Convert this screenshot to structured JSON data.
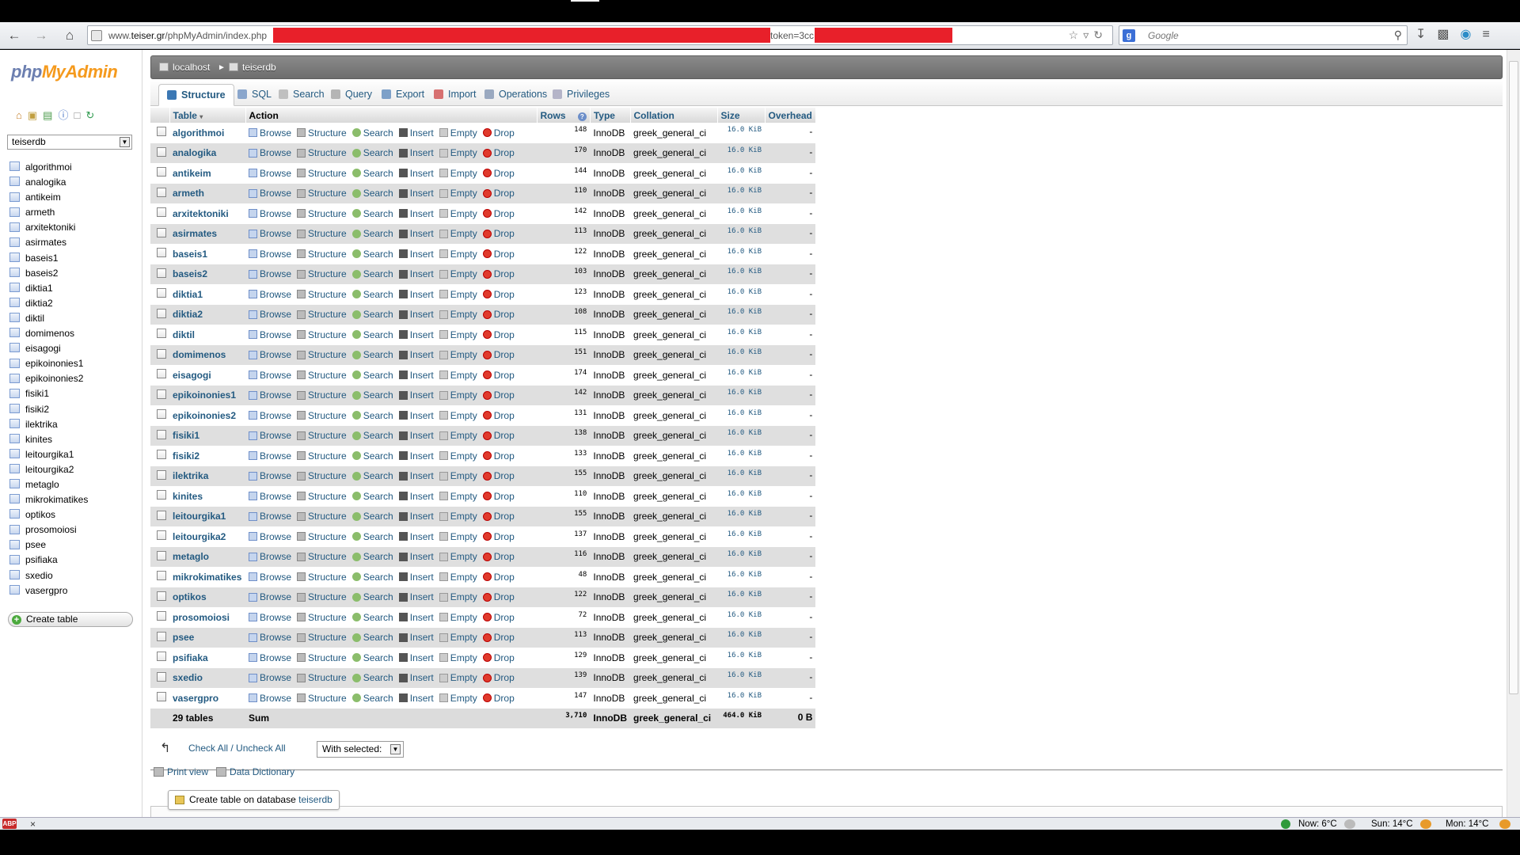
{
  "browser": {
    "url_prefix": "www.",
    "url_domain": "teiser.gr",
    "url_path": "/phpMyAdmin/index.php",
    "url_token": "token=3cc",
    "search_placeholder": "Google"
  },
  "sidebar": {
    "logo_php": "php",
    "logo_myadmin": "MyAdmin",
    "db_selected": "teiserdb",
    "tables": [
      "algorithmoi",
      "analogika",
      "antikeim",
      "armeth",
      "arxitektoniki",
      "asirmates",
      "baseis1",
      "baseis2",
      "diktia1",
      "diktia2",
      "diktil",
      "domimenos",
      "eisagogi",
      "epikoinonies1",
      "epikoinonies2",
      "fisiki1",
      "fisiki2",
      "ilektrika",
      "kinites",
      "leitourgika1",
      "leitourgika2",
      "metaglo",
      "mikrokimatikes",
      "optikos",
      "prosomoiosi",
      "psee",
      "psifiaka",
      "sxedio",
      "vasergpro"
    ],
    "create_table": "Create table"
  },
  "breadcrumb": {
    "server": "localhost",
    "database": "teiserdb"
  },
  "tabs": [
    {
      "label": "Structure",
      "color": "#3c78b4"
    },
    {
      "label": "SQL",
      "color": "#8aa6cc"
    },
    {
      "label": "Search",
      "color": "#c0c0c0"
    },
    {
      "label": "Query",
      "color": "#b5b5b5"
    },
    {
      "label": "Export",
      "color": "#7da0c8"
    },
    {
      "label": "Import",
      "color": "#d77070"
    },
    {
      "label": "Operations",
      "color": "#9aa9c0"
    },
    {
      "label": "Privileges",
      "color": "#b4b4c8"
    }
  ],
  "table": {
    "headers": {
      "table": "Table",
      "action": "Action",
      "rows": "Rows",
      "type": "Type",
      "collation": "Collation",
      "size": "Size",
      "overhead": "Overhead"
    },
    "actions": [
      "Browse",
      "Structure",
      "Search",
      "Insert",
      "Empty",
      "Drop"
    ],
    "rows": [
      {
        "name": "algorithmoi",
        "rows": "148",
        "type": "InnoDB",
        "collation": "greek_general_ci",
        "size": "16.0 KiB",
        "overhead": "-"
      },
      {
        "name": "analogika",
        "rows": "170",
        "type": "InnoDB",
        "collation": "greek_general_ci",
        "size": "16.0 KiB",
        "overhead": "-"
      },
      {
        "name": "antikeim",
        "rows": "144",
        "type": "InnoDB",
        "collation": "greek_general_ci",
        "size": "16.0 KiB",
        "overhead": "-"
      },
      {
        "name": "armeth",
        "rows": "110",
        "type": "InnoDB",
        "collation": "greek_general_ci",
        "size": "16.0 KiB",
        "overhead": "-"
      },
      {
        "name": "arxitektoniki",
        "rows": "142",
        "type": "InnoDB",
        "collation": "greek_general_ci",
        "size": "16.0 KiB",
        "overhead": "-"
      },
      {
        "name": "asirmates",
        "rows": "113",
        "type": "InnoDB",
        "collation": "greek_general_ci",
        "size": "16.0 KiB",
        "overhead": "-"
      },
      {
        "name": "baseis1",
        "rows": "122",
        "type": "InnoDB",
        "collation": "greek_general_ci",
        "size": "16.0 KiB",
        "overhead": "-"
      },
      {
        "name": "baseis2",
        "rows": "103",
        "type": "InnoDB",
        "collation": "greek_general_ci",
        "size": "16.0 KiB",
        "overhead": "-"
      },
      {
        "name": "diktia1",
        "rows": "123",
        "type": "InnoDB",
        "collation": "greek_general_ci",
        "size": "16.0 KiB",
        "overhead": "-"
      },
      {
        "name": "diktia2",
        "rows": "108",
        "type": "InnoDB",
        "collation": "greek_general_ci",
        "size": "16.0 KiB",
        "overhead": "-"
      },
      {
        "name": "diktil",
        "rows": "115",
        "type": "InnoDB",
        "collation": "greek_general_ci",
        "size": "16.0 KiB",
        "overhead": "-"
      },
      {
        "name": "domimenos",
        "rows": "151",
        "type": "InnoDB",
        "collation": "greek_general_ci",
        "size": "16.0 KiB",
        "overhead": "-"
      },
      {
        "name": "eisagogi",
        "rows": "174",
        "type": "InnoDB",
        "collation": "greek_general_ci",
        "size": "16.0 KiB",
        "overhead": "-"
      },
      {
        "name": "epikoinonies1",
        "rows": "142",
        "type": "InnoDB",
        "collation": "greek_general_ci",
        "size": "16.0 KiB",
        "overhead": "-"
      },
      {
        "name": "epikoinonies2",
        "rows": "131",
        "type": "InnoDB",
        "collation": "greek_general_ci",
        "size": "16.0 KiB",
        "overhead": "-"
      },
      {
        "name": "fisiki1",
        "rows": "138",
        "type": "InnoDB",
        "collation": "greek_general_ci",
        "size": "16.0 KiB",
        "overhead": "-"
      },
      {
        "name": "fisiki2",
        "rows": "133",
        "type": "InnoDB",
        "collation": "greek_general_ci",
        "size": "16.0 KiB",
        "overhead": "-"
      },
      {
        "name": "ilektrika",
        "rows": "155",
        "type": "InnoDB",
        "collation": "greek_general_ci",
        "size": "16.0 KiB",
        "overhead": "-"
      },
      {
        "name": "kinites",
        "rows": "110",
        "type": "InnoDB",
        "collation": "greek_general_ci",
        "size": "16.0 KiB",
        "overhead": "-"
      },
      {
        "name": "leitourgika1",
        "rows": "155",
        "type": "InnoDB",
        "collation": "greek_general_ci",
        "size": "16.0 KiB",
        "overhead": "-"
      },
      {
        "name": "leitourgika2",
        "rows": "137",
        "type": "InnoDB",
        "collation": "greek_general_ci",
        "size": "16.0 KiB",
        "overhead": "-"
      },
      {
        "name": "metaglo",
        "rows": "116",
        "type": "InnoDB",
        "collation": "greek_general_ci",
        "size": "16.0 KiB",
        "overhead": "-"
      },
      {
        "name": "mikrokimatikes",
        "rows": "48",
        "type": "InnoDB",
        "collation": "greek_general_ci",
        "size": "16.0 KiB",
        "overhead": "-"
      },
      {
        "name": "optikos",
        "rows": "122",
        "type": "InnoDB",
        "collation": "greek_general_ci",
        "size": "16.0 KiB",
        "overhead": "-"
      },
      {
        "name": "prosomoiosi",
        "rows": "72",
        "type": "InnoDB",
        "collation": "greek_general_ci",
        "size": "16.0 KiB",
        "overhead": "-"
      },
      {
        "name": "psee",
        "rows": "113",
        "type": "InnoDB",
        "collation": "greek_general_ci",
        "size": "16.0 KiB",
        "overhead": "-"
      },
      {
        "name": "psifiaka",
        "rows": "129",
        "type": "InnoDB",
        "collation": "greek_general_ci",
        "size": "16.0 KiB",
        "overhead": "-"
      },
      {
        "name": "sxedio",
        "rows": "139",
        "type": "InnoDB",
        "collation": "greek_general_ci",
        "size": "16.0 KiB",
        "overhead": "-"
      },
      {
        "name": "vasergpro",
        "rows": "147",
        "type": "InnoDB",
        "collation": "greek_general_ci",
        "size": "16.0 KiB",
        "overhead": "-"
      }
    ],
    "footer": {
      "count": "29 tables",
      "action": "Sum",
      "rows": "3,710",
      "type": "InnoDB",
      "collation": "greek_general_ci",
      "size": "464.0 KiB",
      "overhead": "0 B"
    }
  },
  "bulk": {
    "check_all": "Check All / Uncheck All",
    "with_selected": "With selected:"
  },
  "links": {
    "print_view": "Print view",
    "data_dictionary": "Data Dictionary"
  },
  "create_on_db": {
    "label": "Create table on database",
    "db": "teiserdb"
  },
  "statusbar": {
    "abp": "ABP",
    "now": "Now: 6°C",
    "sun": "Sun: 14°C",
    "mon": "Mon: 14°C"
  }
}
